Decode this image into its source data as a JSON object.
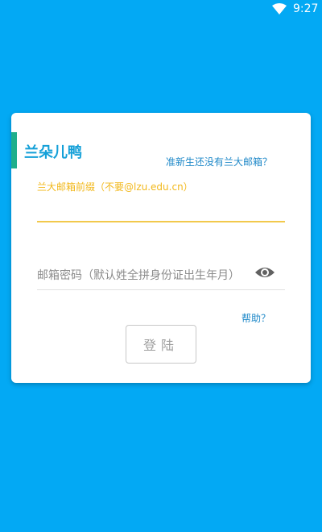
{
  "status_bar": {
    "time": "9:27",
    "wifi_icon": "wifi-icon"
  },
  "login_card": {
    "title": "兰朵儿鸭",
    "register_link": "准新生还没有兰大邮箱？",
    "email": {
      "label": "兰大邮箱前缀（不要@lzu.edu.cn）",
      "value": "",
      "placeholder": ""
    },
    "password": {
      "value": "",
      "placeholder": "邮箱密码（默认姓全拼身份证出生年月）",
      "toggle_icon": "eye-icon"
    },
    "help_link": "帮助？",
    "login_button": "登陆"
  },
  "colors": {
    "background": "#03A9F4",
    "title": "#14A0D8",
    "accent": "#1FAF8B",
    "label": "#F2B81B",
    "link": "#1E88C8"
  }
}
